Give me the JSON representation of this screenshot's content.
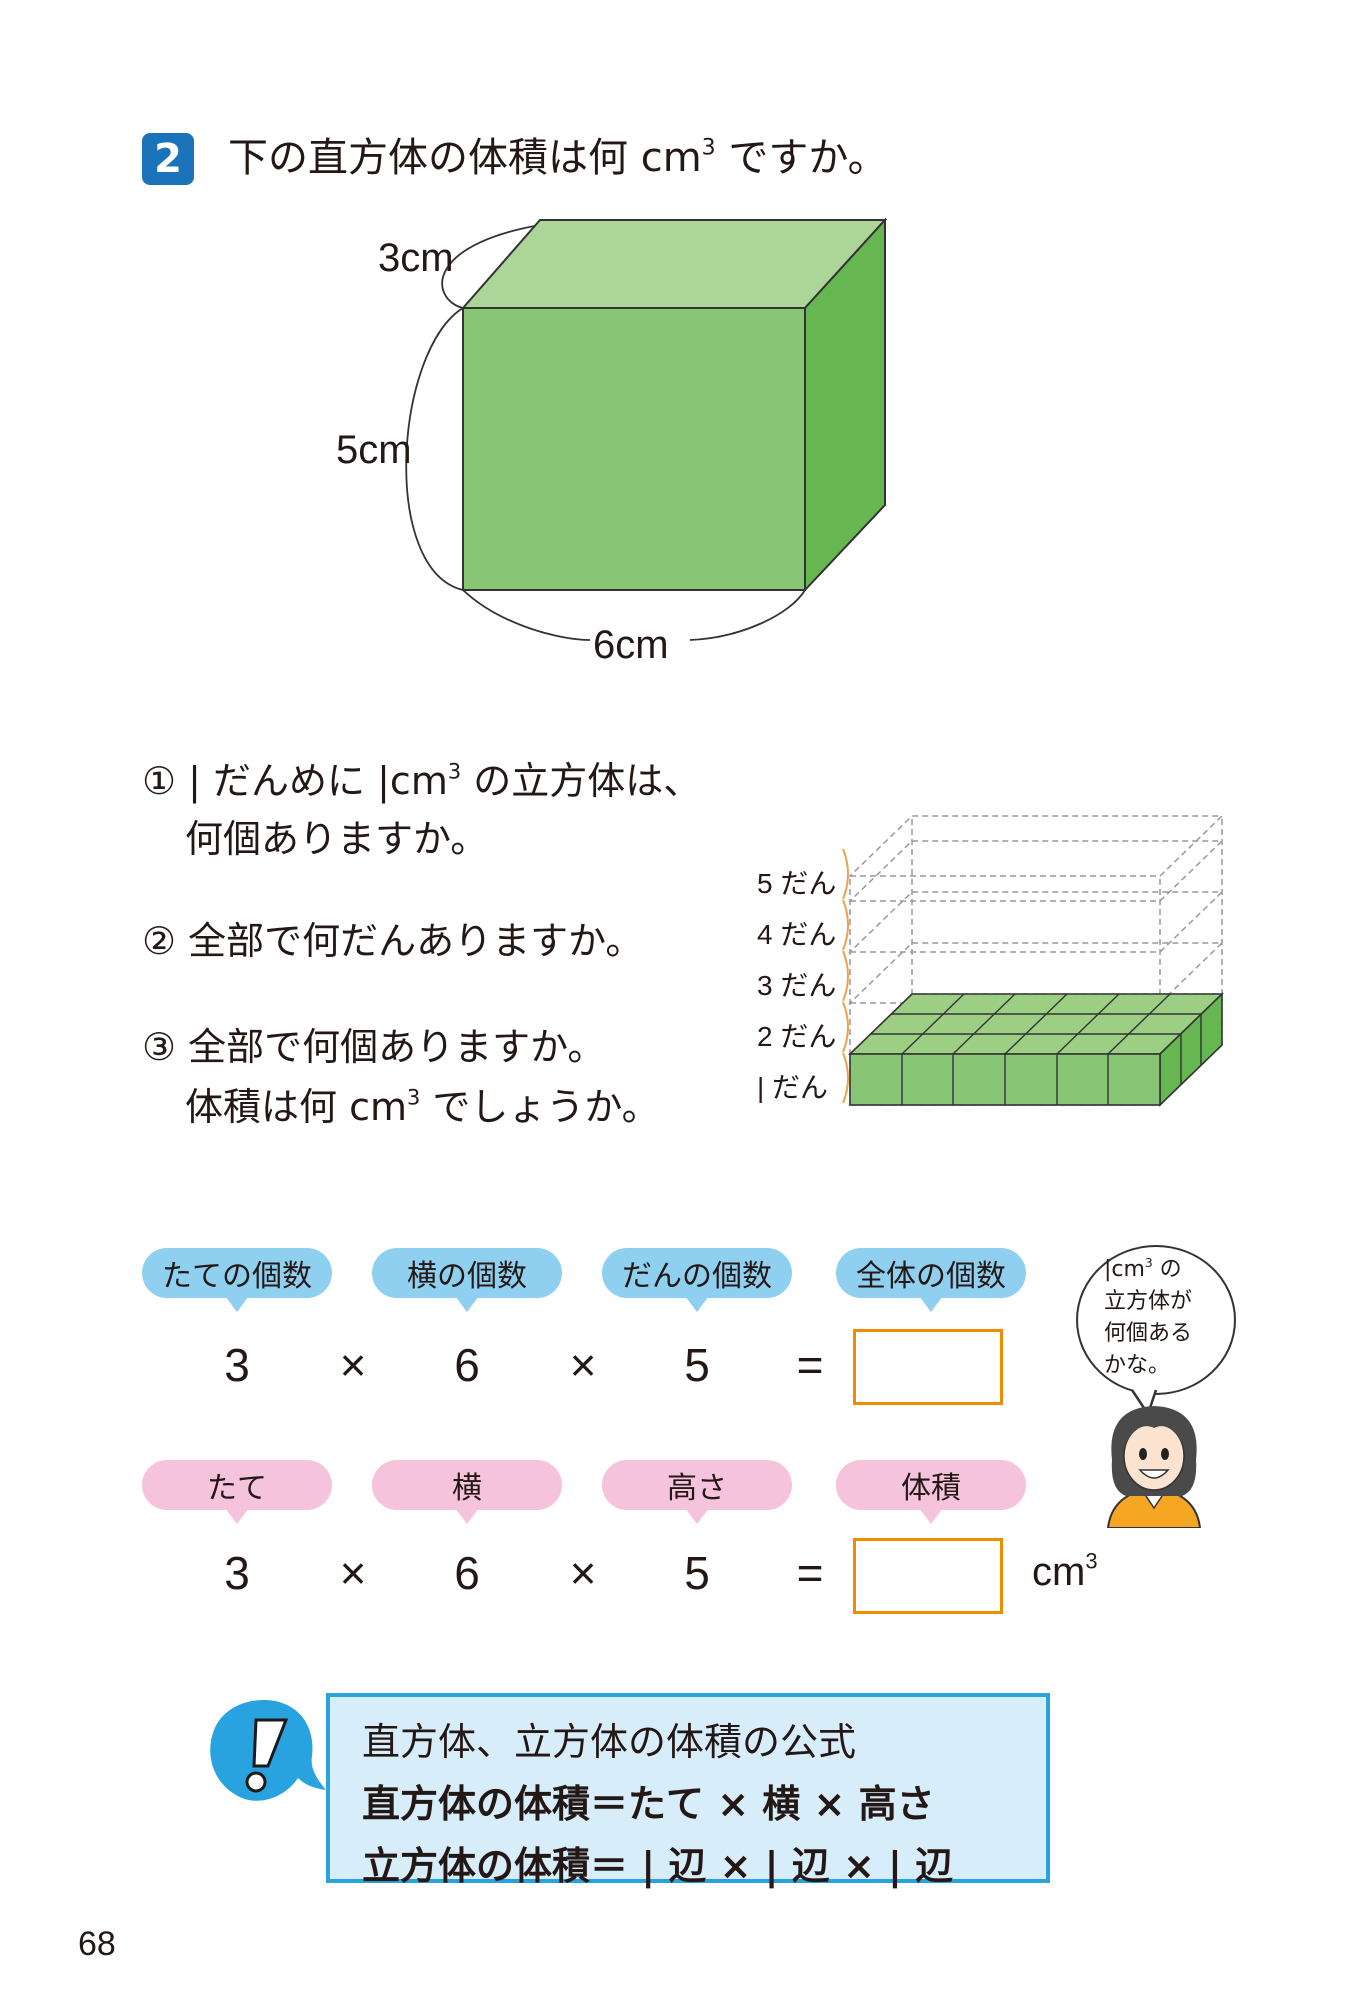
{
  "question": {
    "number": "2",
    "text_before": "下の直方体の体積は何 cm",
    "sup": "3",
    "text_after": " ですか。"
  },
  "box_labels": {
    "depth": "3cm",
    "height": "5cm",
    "width": "6cm"
  },
  "subquestions": {
    "q1_line1_a": "① ",
    "q1_line1_b": "| だんめに |cm",
    "q1_sup": "3",
    "q1_line1_c": " の立方体は、",
    "q1_line2": "何個ありますか。",
    "q2": "② 全部で何だんありますか。",
    "q3_line1": "③ 全部で何個ありますか。",
    "q3_line2_a": "体積は何 cm",
    "q3_sup": "3",
    "q3_line2_b": " でしょうか。"
  },
  "steps": [
    "5 だん",
    "4 だん",
    "3 だん",
    "2 だん",
    "| だん"
  ],
  "row1": {
    "labels": [
      "たての個数",
      "横の個数",
      "だんの個数",
      "全体の個数"
    ],
    "n1": "3",
    "op1": "×",
    "n2": "6",
    "op2": "×",
    "n3": "5",
    "eq": "="
  },
  "row2": {
    "labels": [
      "たて",
      "横",
      "高さ",
      "体積"
    ],
    "n1": "3",
    "op1": "×",
    "n2": "6",
    "op2": "×",
    "n3": "5",
    "eq": "=",
    "unit": "cm",
    "unit_sup": "3"
  },
  "speech": {
    "line1_a": "|cm",
    "line1_sup": "3",
    "line1_b": " の",
    "line2": "立方体が",
    "line3": "何個ある",
    "line4": "かな。"
  },
  "formula": {
    "title": "直方体、立方体の体積の公式",
    "line1": "直方体の体積＝たて × 横 × 高さ",
    "line2": "立方体の体積＝ | 辺 × | 辺 × | 辺"
  },
  "page_number": "68",
  "colors": {
    "cube_front": "#88c676",
    "cube_top": "#acd597",
    "cube_side": "#66b752",
    "question_badge": "#1b73b9",
    "answer_box_border": "#f08c00",
    "blue_label": "#8fcff0",
    "pink_label": "#f5c3dc",
    "formula_border": "#29a3df",
    "formula_bg": "#d7eefa"
  }
}
